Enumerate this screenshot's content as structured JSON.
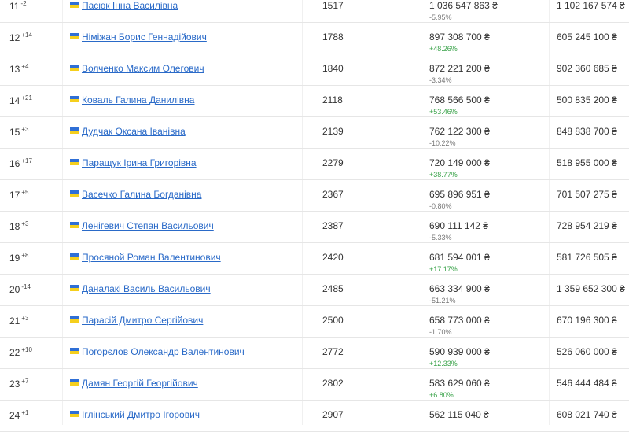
{
  "colors": {
    "link": "#2a6ac8",
    "positive": "#3aa34a",
    "negative": "#777777",
    "flag_blue": "#2f6fd6",
    "flag_yellow": "#f5cf1d"
  },
  "flag_icon": "ukraine-flag-icon",
  "rows": [
    {
      "rank": "11",
      "delta": "-2",
      "name": "Пасюк Інна Василівна",
      "number": "1517",
      "current": "1 036 547 863 ₴",
      "change": "-5.95%",
      "trend": "down",
      "previous": "1 102 167 574 ₴"
    },
    {
      "rank": "12",
      "delta": "+14",
      "name": "Німіжан Борис Геннадійович",
      "number": "1788",
      "current": "897 308 700 ₴",
      "change": "+48.26%",
      "trend": "up",
      "previous": "605 245 100 ₴"
    },
    {
      "rank": "13",
      "delta": "+4",
      "name": "Волченко Максим Олегович",
      "number": "1840",
      "current": "872 221 200 ₴",
      "change": "-3.34%",
      "trend": "down",
      "previous": "902 360 685 ₴"
    },
    {
      "rank": "14",
      "delta": "+21",
      "name": "Коваль Галина Данилівна",
      "number": "2118",
      "current": "768 566 500 ₴",
      "change": "+53.46%",
      "trend": "up",
      "previous": "500 835 200 ₴"
    },
    {
      "rank": "15",
      "delta": "+3",
      "name": "Дудчак Оксана Іванівна",
      "number": "2139",
      "current": "762 122 300 ₴",
      "change": "-10.22%",
      "trend": "down",
      "previous": "848 838 700 ₴"
    },
    {
      "rank": "16",
      "delta": "+17",
      "name": "Паращук Ірина Григорівна",
      "number": "2279",
      "current": "720 149 000 ₴",
      "change": "+38.77%",
      "trend": "up",
      "previous": "518 955 000 ₴"
    },
    {
      "rank": "17",
      "delta": "+5",
      "name": "Васечко Галина Богданівна",
      "number": "2367",
      "current": "695 896 951 ₴",
      "change": "-0.80%",
      "trend": "down",
      "previous": "701 507 275 ₴"
    },
    {
      "rank": "18",
      "delta": "+3",
      "name": "Ленігевич Степан Васильович",
      "number": "2387",
      "current": "690 111 142 ₴",
      "change": "-5.33%",
      "trend": "down",
      "previous": "728 954 219 ₴"
    },
    {
      "rank": "19",
      "delta": "+8",
      "name": "Просяной Роман Валентинович",
      "number": "2420",
      "current": "681 594 001 ₴",
      "change": "+17.17%",
      "trend": "up",
      "previous": "581 726 505 ₴"
    },
    {
      "rank": "20",
      "delta": "-14",
      "name": "Даналакі Василь Васильович",
      "number": "2485",
      "current": "663 334 900 ₴",
      "change": "-51.21%",
      "trend": "down",
      "previous": "1 359 652 300 ₴"
    },
    {
      "rank": "21",
      "delta": "+3",
      "name": "Парасій Дмитро Сергійович",
      "number": "2500",
      "current": "658 773 000 ₴",
      "change": "-1.70%",
      "trend": "down",
      "previous": "670 196 300 ₴"
    },
    {
      "rank": "22",
      "delta": "+10",
      "name": "Погорєлов Олександр Валентинович",
      "number": "2772",
      "current": "590 939 000 ₴",
      "change": "+12.33%",
      "trend": "up",
      "previous": "526 060 000 ₴"
    },
    {
      "rank": "23",
      "delta": "+7",
      "name": "Дамян Георгій Георгійович",
      "number": "2802",
      "current": "583 629 060 ₴",
      "change": "+6.80%",
      "trend": "up",
      "previous": "546 444 484 ₴"
    },
    {
      "rank": "24",
      "delta": "+1",
      "name": "Іглінський Дмитро Ігорович",
      "number": "2907",
      "current": "562 115 040 ₴",
      "change": "",
      "trend": "",
      "previous": "608 021 740 ₴"
    }
  ]
}
